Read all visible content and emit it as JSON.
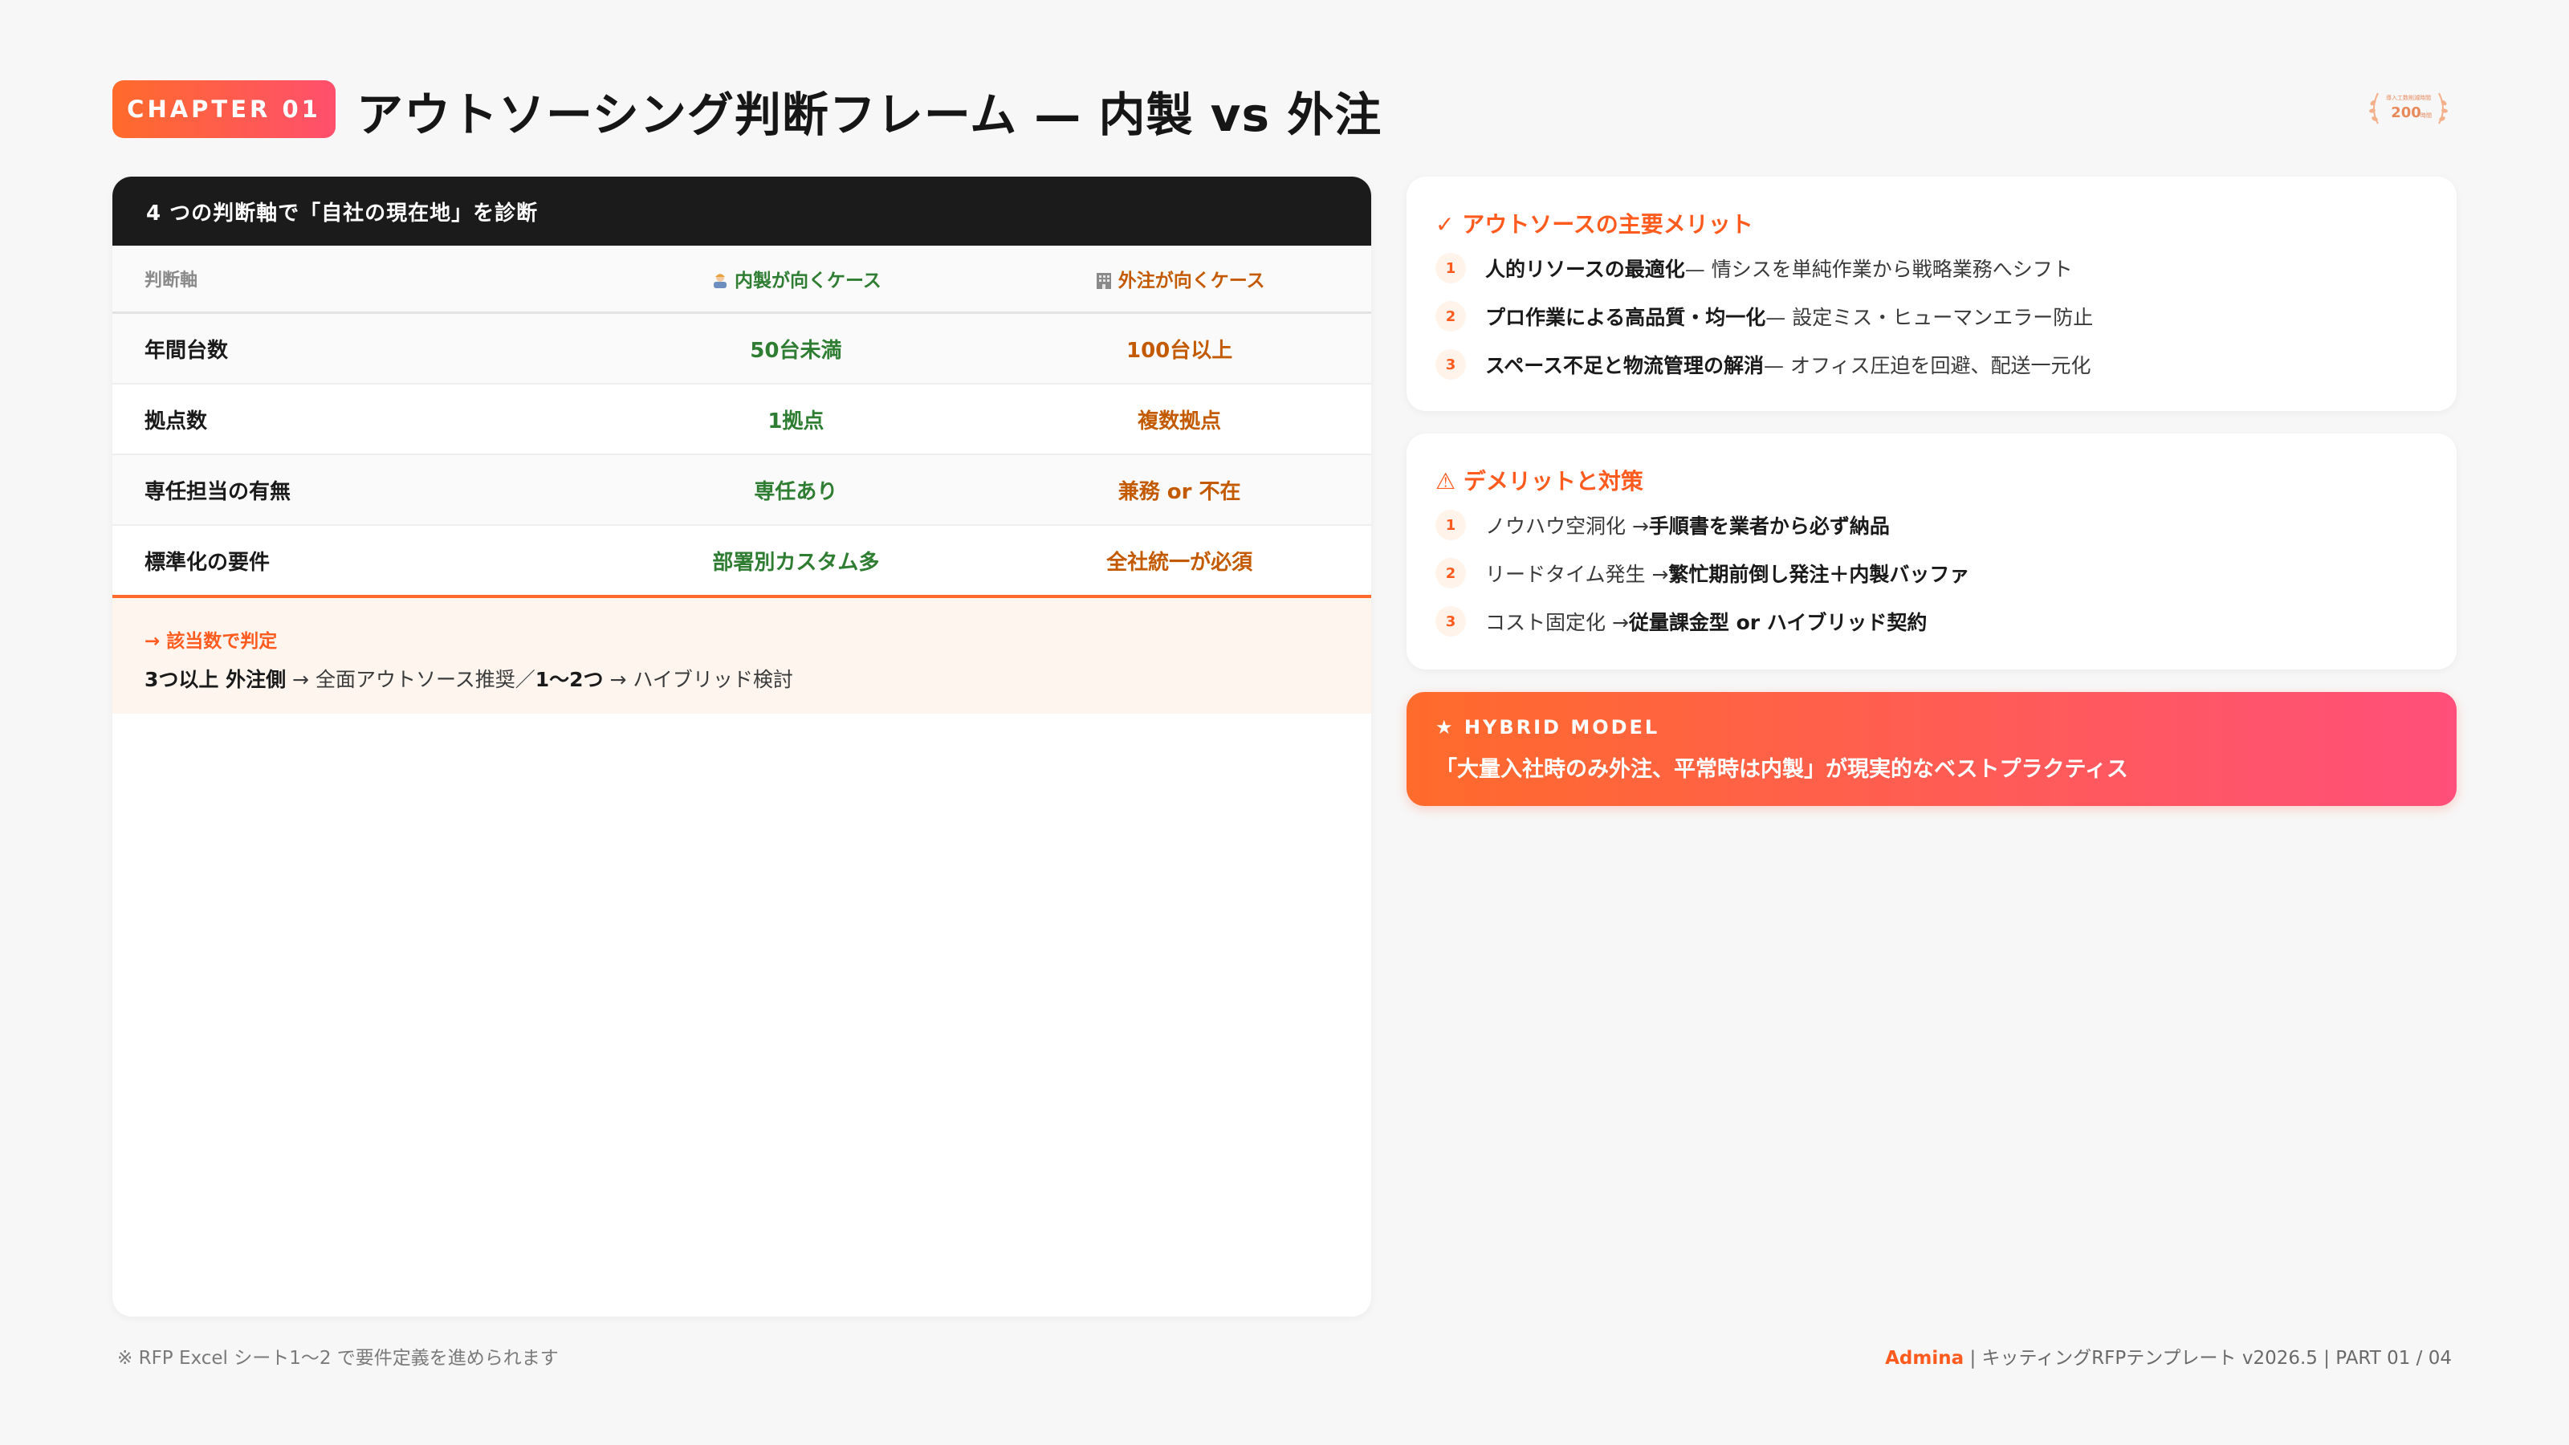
{
  "header": {
    "chapter": "CHAPTER 01",
    "title": "アウトソーシング判断フレーム — 内製 vs 外注"
  },
  "award_badge": {
    "line1": "導入工数削減時間",
    "value": "200",
    "unit": "時間"
  },
  "left": {
    "header": "4 つの判断軸で「自社の現在地」を診断",
    "columns": [
      "判断軸",
      "内製が向くケース",
      "外注が向くケース"
    ],
    "rows": [
      {
        "axis": "年間台数",
        "inhouse": "50台未満",
        "outsource": "100台以上"
      },
      {
        "axis": "拠点数",
        "inhouse": "1拠点",
        "outsource": "複数拠点"
      },
      {
        "axis": "専任担当の有無",
        "inhouse": "専任あり",
        "outsource": "兼務 or 不在"
      },
      {
        "axis": "標準化の要件",
        "inhouse": "部署別カスタム多",
        "outsource": "全社統一が必須"
      }
    ],
    "judge": {
      "label": "→ 該当数で判定",
      "strong1": "3つ以上 外注側",
      "text1": " → 全面アウトソース推奨／",
      "strong2": "1〜2つ",
      "text2": " → ハイブリッド検討"
    }
  },
  "merits": {
    "title": "✓ アウトソースの主要メリット",
    "items": [
      {
        "num": "1",
        "bold": "人的リソースの最適化",
        "text": " — 情シスを単純作業から戦略業務へシフト"
      },
      {
        "num": "2",
        "bold": "プロ作業による高品質・均一化",
        "text": " — 設定ミス・ヒューマンエラー防止"
      },
      {
        "num": "3",
        "bold": "スペース不足と物流管理の解消",
        "text": " — オフィス圧迫を回避、配送一元化"
      }
    ]
  },
  "demerits": {
    "title": "⚠ デメリットと対策",
    "items": [
      {
        "num": "1",
        "text": "ノウハウ空洞化 → ",
        "bold": "手順書を業者から必ず納品"
      },
      {
        "num": "2",
        "text": "リードタイム発生 → ",
        "bold": "繁忙期前倒し発注＋内製バッファ"
      },
      {
        "num": "3",
        "text": "コスト固定化 → ",
        "bold": "従量課金型 or ハイブリッド契約"
      }
    ]
  },
  "hybrid": {
    "label": "★ HYBRID MODEL",
    "text": "「大量入社時のみ外注、平常時は内製」が現実的なベストプラクティス"
  },
  "footer": {
    "note": "※ RFP Excel シート1〜2 で要件定義を進められます",
    "brand": "Admina",
    "info": " | キッティングRFPテンプレート v2026.5 | PART 01 / 04"
  },
  "colors": {
    "accent": "#ff5b1f",
    "green": "#2e7d32",
    "orange_text": "#c35a00",
    "dark": "#1b1b1b"
  }
}
